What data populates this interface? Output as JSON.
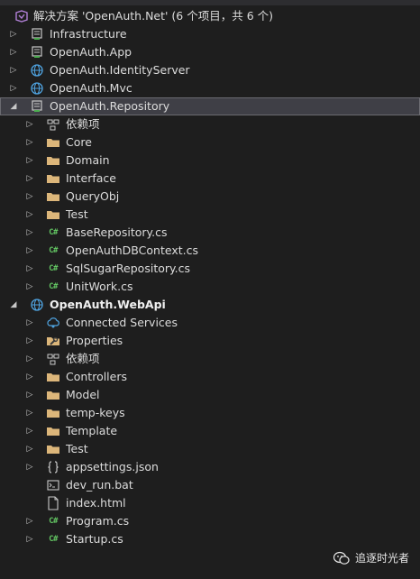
{
  "window": {
    "partial_title": "~~~~~~~~~~~~~~~~~~~~~~"
  },
  "solution": {
    "label": "解决方案 'OpenAuth.Net' (6 个项目，共 6 个)"
  },
  "projects": {
    "infrastructure": "Infrastructure",
    "app": "OpenAuth.App",
    "identity": "OpenAuth.IdentityServer",
    "mvc": "OpenAuth.Mvc",
    "repository": "OpenAuth.Repository",
    "webapi": "OpenAuth.WebApi"
  },
  "repository_items": {
    "deps": "依赖项",
    "core": "Core",
    "domain": "Domain",
    "interface": "Interface",
    "queryobj": "QueryObj",
    "test": "Test",
    "base_repo": "BaseRepository.cs",
    "dbcontext": "OpenAuthDBContext.cs",
    "sqlsugar": "SqlSugarRepository.cs",
    "unitwork": "UnitWork.cs"
  },
  "webapi_items": {
    "connected": "Connected Services",
    "properties": "Properties",
    "deps": "依赖项",
    "controllers": "Controllers",
    "model": "Model",
    "tempkeys": "temp-keys",
    "template": "Template",
    "test": "Test",
    "appsettings": "appsettings.json",
    "devrun": "dev_run.bat",
    "index": "index.html",
    "program": "Program.cs",
    "startup": "Startup.cs"
  },
  "watermark": {
    "text": "追逐时光者"
  },
  "colors": {
    "background": "#1e1e1e",
    "selected": "#3f3f46",
    "folder": "#dcb67a",
    "csharp": "#63c663",
    "text": "#dcdcdc"
  }
}
